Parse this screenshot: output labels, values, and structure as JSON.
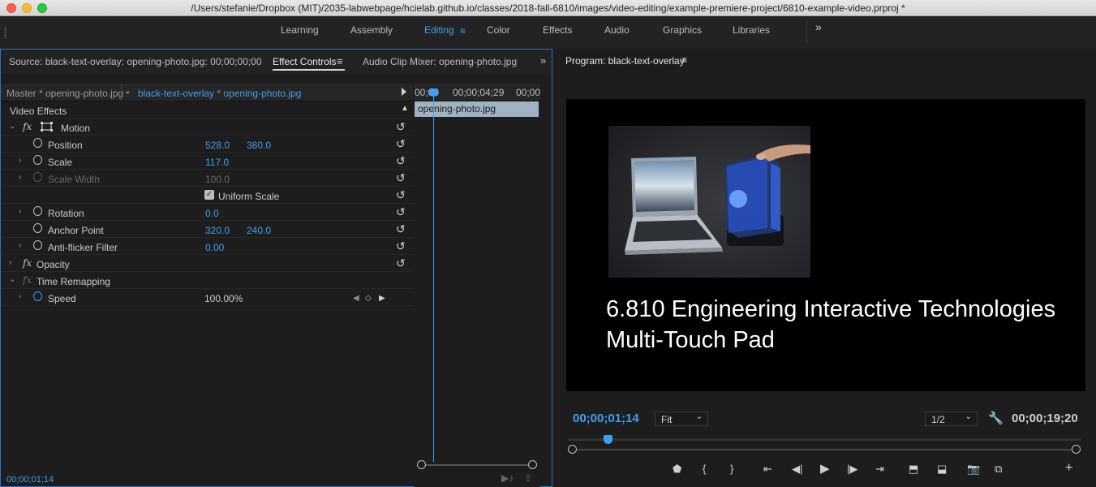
{
  "window": {
    "title": "/Users/stefanie/Dropbox (MIT)/2035-labwebpage/hcielab.github.io/classes/2018-fall-6810/images/video-editing/example-premiere-project/6810-example-video.prproj *"
  },
  "workspaces": [
    "Learning",
    "Assembly",
    "Editing",
    "Color",
    "Effects",
    "Audio",
    "Graphics",
    "Libraries"
  ],
  "workspace_more": "»",
  "source_panel": {
    "tabs": {
      "source": "Source: black-text-overlay: opening-photo.jpg: 00;00;00;00",
      "effect_controls": "Effect Controls",
      "audio_mixer": "Audio Clip Mixer: opening-photo.jpg"
    },
    "master_clip": "Master * opening-photo.jpg",
    "sequence_clip": "black-text-overlay * opening-photo.jpg",
    "section": "Video Effects",
    "effects": {
      "motion": "Motion",
      "position": {
        "label": "Position",
        "x": "528.0",
        "y": "380.0"
      },
      "scale": {
        "label": "Scale",
        "value": "117.0"
      },
      "scale_width": {
        "label": "Scale Width",
        "value": "100.0"
      },
      "uniform_scale": "Uniform Scale",
      "rotation": {
        "label": "Rotation",
        "value": "0.0"
      },
      "anchor": {
        "label": "Anchor Point",
        "x": "320.0",
        "y": "240.0"
      },
      "antiflicker": {
        "label": "Anti-flicker Filter",
        "value": "0.00"
      },
      "opacity": "Opacity",
      "time_remapping": "Time Remapping",
      "speed": {
        "label": "Speed",
        "value": "100.00%"
      }
    },
    "mini_timeline": {
      "tc_start": "00;00",
      "tc_mid": "00;00;04;29",
      "tc_end": "00;00",
      "clip": "opening-photo.jpg"
    },
    "footer_timecode": "00;00;01;14"
  },
  "program": {
    "title": "Program: black-text-overlay",
    "caption_line1": "6.810 Engineering Interactive Technologies",
    "caption_line2": "Multi-Touch Pad",
    "current_timecode": "00;00;01;14",
    "zoom": "Fit",
    "resolution": "1/2",
    "duration": "00;00;19;20",
    "playhead_fraction": 0.07
  },
  "colors": {
    "accent": "#3f9ff2",
    "panel_border": "#2c6fc4"
  }
}
